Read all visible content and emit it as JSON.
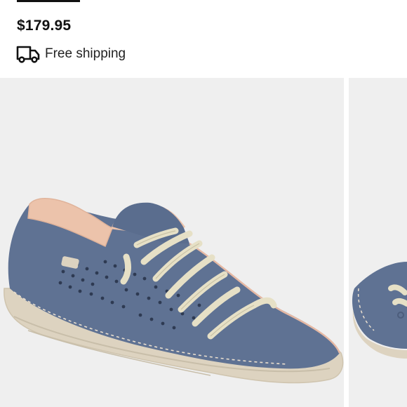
{
  "product": {
    "price": "$179.95",
    "shipping_label": "Free shipping",
    "shipping_icon": "delivery-truck-icon"
  },
  "gallery": {
    "main_image": "blue-perforated-suede-sneaker-photo",
    "next_image": "blue-suede-sneaker-alternate-view-photo"
  },
  "colors": {
    "suede": "#5f7293",
    "sole": "#ddd3c0",
    "laces": "#e6e0c6",
    "lining": "#ecc3ab",
    "background": "#efefef"
  }
}
